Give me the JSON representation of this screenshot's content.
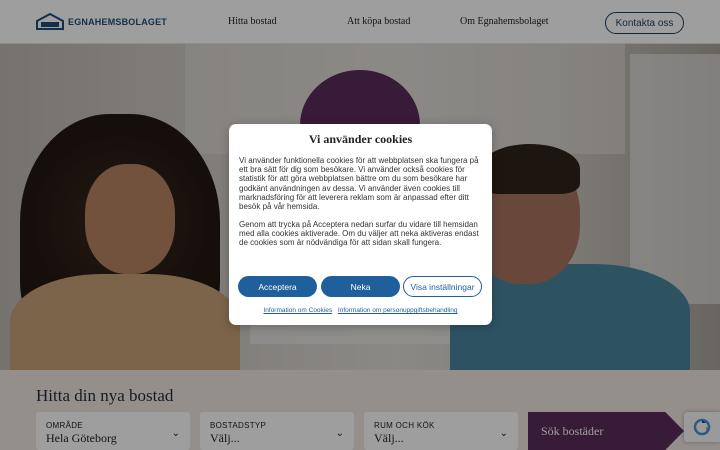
{
  "header": {
    "logo_text": "EGNAHEMSBOLAGET",
    "nav": [
      "Hitta bostad",
      "Att köpa bostad",
      "Om Egnahemsbolaget"
    ],
    "contact_label": "Kontakta oss"
  },
  "cookie_modal": {
    "title": "Vi använder cookies",
    "paragraph_1": "Vi använder funktionella cookies för att webbplatsen ska fungera på ett bra sätt för dig som besökare. Vi använder också cookies för statistik för att göra webbplatsen bättre om du som besökare har godkänt användningen av dessa. Vi använder även cookies till marknadsföring för att leverera reklam som är anpassad efter ditt besök på vår hemsida.",
    "paragraph_2": "Genom att trycka på Acceptera nedan surfar du vidare till hemsidan med alla cookies aktiverade. Om du väljer att neka aktiveras endast de cookies som är nödvändiga för att sidan skall fungera.",
    "accept_label": "Acceptera",
    "decline_label": "Neka",
    "settings_label": "Visa inställningar",
    "link_cookies": "Information om Cookies",
    "link_privacy": "Information om personuppgiftsbehandling"
  },
  "search": {
    "title": "Hitta din nya bostad",
    "fields": [
      {
        "label": "OMRÅDE",
        "value": "Hela Göteborg"
      },
      {
        "label": "BOSTADSTYP",
        "value": "Välj..."
      },
      {
        "label": "RUM OCH KÖK",
        "value": "Välj..."
      }
    ],
    "button_label": "Sök bostäder"
  },
  "colors": {
    "brand_blue": "#1f4e79",
    "brand_purple": "#5b2d5c",
    "button_blue": "#1f5f9c",
    "search_bg": "#f1e7e2"
  },
  "icons": [
    "logo-house-icon",
    "chevron-down-icon",
    "recaptcha-icon"
  ]
}
